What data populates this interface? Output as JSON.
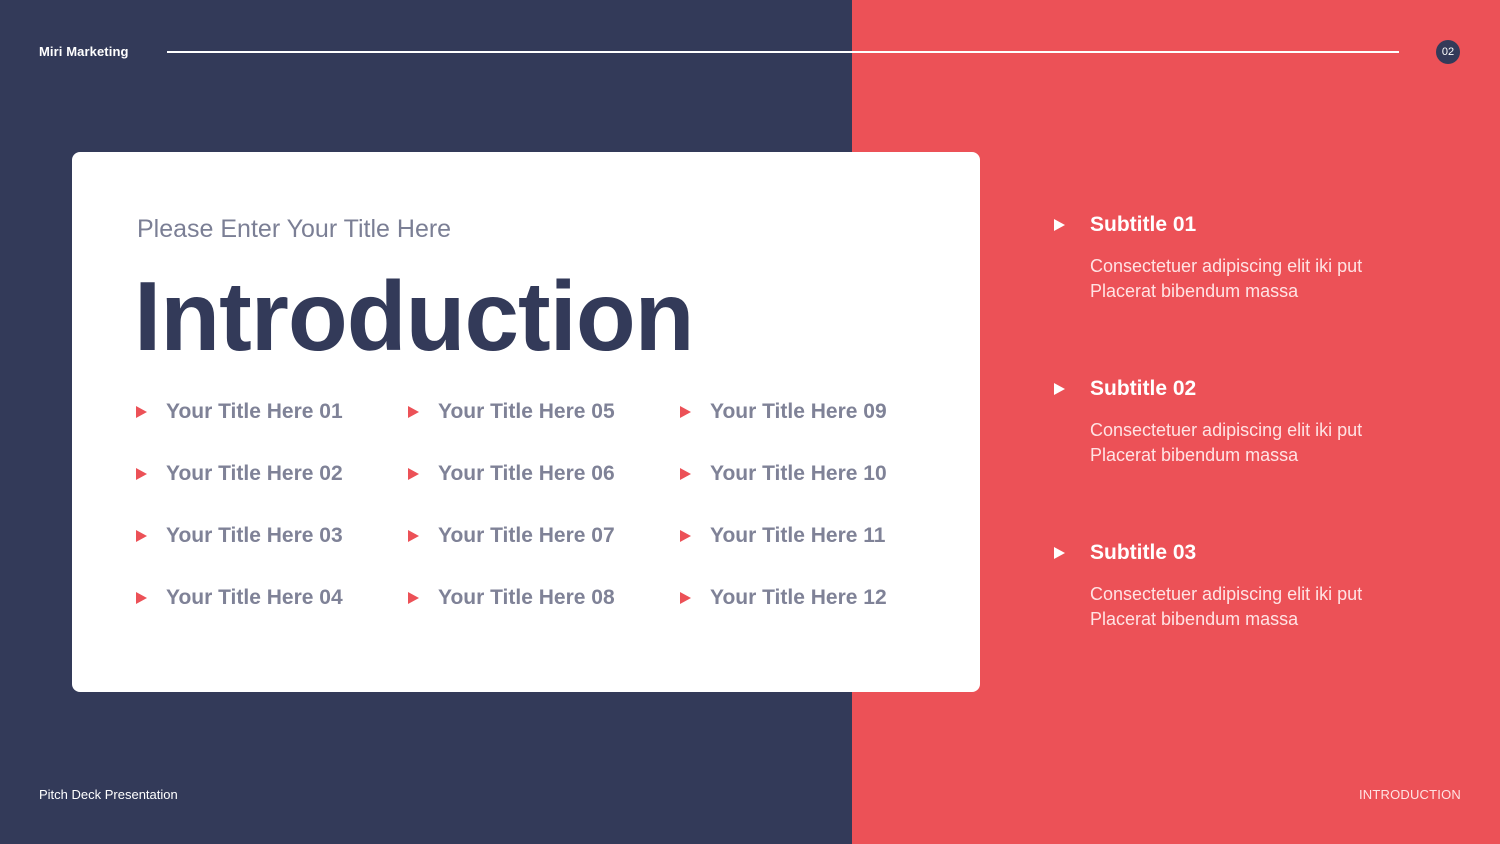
{
  "header": {
    "brand": "Miri Marketing",
    "page_number": "02"
  },
  "card": {
    "subtitle": "Please Enter Your Title Here",
    "title": "Introduction",
    "items": [
      "Your Title Here 01",
      "Your Title Here 02",
      "Your Title Here 03",
      "Your Title Here 04",
      "Your Title Here 05",
      "Your Title Here 06",
      "Your Title Here 07",
      "Your Title Here 08",
      "Your Title Here 09",
      "Your Title Here 10",
      "Your Title Here 11",
      "Your Title Here 12"
    ]
  },
  "subtitles": [
    {
      "title": "Subtitle 01",
      "line1": "Consectetuer adipiscing elit iki put",
      "line2": "Placerat bibendum massa"
    },
    {
      "title": "Subtitle 02",
      "line1": "Consectetuer adipiscing elit iki put",
      "line2": "Placerat bibendum massa"
    },
    {
      "title": "Subtitle 03",
      "line1": "Consectetuer adipiscing elit iki put",
      "line2": "Placerat bibendum massa"
    }
  ],
  "footer": {
    "left": "Pitch Deck Presentation",
    "right": "INTRODUCTION"
  },
  "colors": {
    "navy": "#333a59",
    "coral": "#ec5157",
    "gray_text": "#7f8297",
    "white": "#ffffff"
  },
  "icons": {
    "bullet": "triangle-right-icon"
  }
}
